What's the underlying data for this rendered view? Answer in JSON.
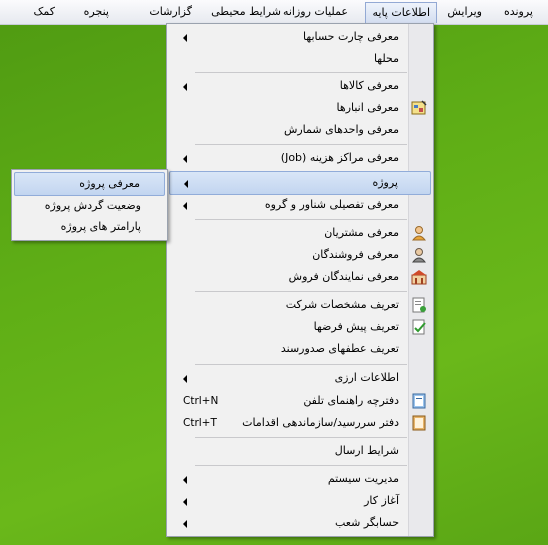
{
  "menubar": {
    "items": [
      {
        "label": "پرونده"
      },
      {
        "label": "ویرایش"
      },
      {
        "label": "اطلاعات پایه"
      },
      {
        "label": "عملیات روزانه"
      },
      {
        "label": "شرایط محیطی"
      },
      {
        "label": "گزارشات"
      },
      {
        "label": "پنجره"
      },
      {
        "label": "کمک"
      }
    ]
  },
  "menu": {
    "items": [
      {
        "label": "معرفی چارت حسابها"
      },
      {
        "label": "محلها"
      },
      {
        "label": "معرفی کالاها"
      },
      {
        "label": "معرفی انبارها",
        "icon": "warehouse-icon"
      },
      {
        "label": "معرفی  واحدهای شمارش"
      },
      {
        "label": "معرفی مراکز هزینه (Job)"
      },
      {
        "label": "پروژه"
      },
      {
        "label": "معرفی تفصیلی شناور و گروه"
      },
      {
        "label": "معرفی مشتریان",
        "icon": "customer-icon"
      },
      {
        "label": "معرفی فروشندگان",
        "icon": "seller-icon"
      },
      {
        "label": "معرفی نمایندگان فروش",
        "icon": "agents-icon"
      },
      {
        "label": "تعریف مشخصات شرکت",
        "icon": "company-icon"
      },
      {
        "label": "تعریف پیش فرضها",
        "icon": "defaults-icon"
      },
      {
        "label": "تعریف عطفهای صدورسند"
      },
      {
        "label": "اطلاعات ارزی"
      },
      {
        "label": "دفترچه راهنمای تلفن",
        "shortcut": "Ctrl+N",
        "icon": "phonebook-icon"
      },
      {
        "label": "دفتر سررسید/سازماندهی اقدامات",
        "shortcut": "Ctrl+T",
        "icon": "planner-icon"
      },
      {
        "label": "شرایط ارسال"
      },
      {
        "label": "مدیریت سیستم"
      },
      {
        "label": "آغاز کار"
      },
      {
        "label": "حسابگر شعب"
      }
    ]
  },
  "submenu": {
    "items": [
      {
        "label": "معرفی پروژه"
      },
      {
        "label": "وضعیت گردش پروژه"
      },
      {
        "label": "پارامتر های پروژه"
      }
    ]
  },
  "colors": {
    "desktop": "#5fae16",
    "highlight": "#c2d5f0",
    "menu_bg": "#f1f1f1"
  }
}
